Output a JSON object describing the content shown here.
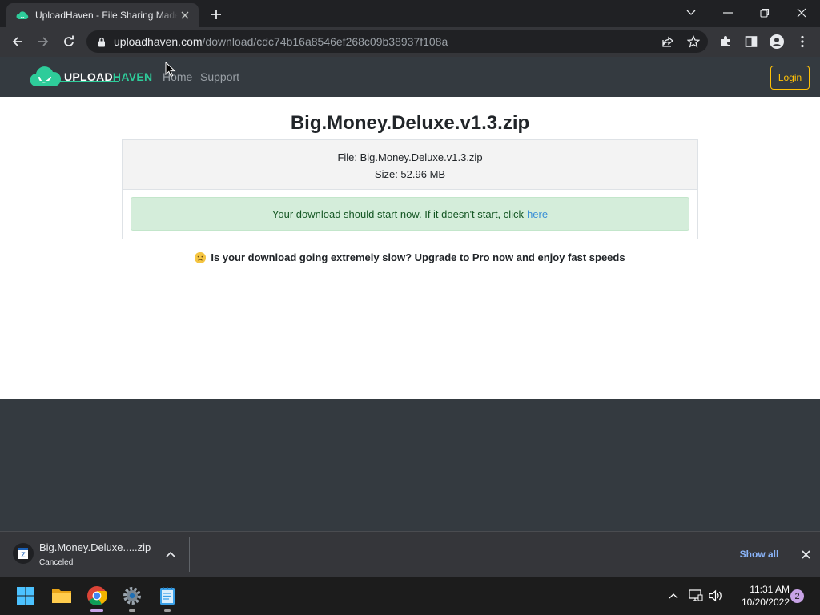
{
  "browser": {
    "tab_title": "UploadHaven - File Sharing Made",
    "url_host": "uploadhaven.com",
    "url_path": "/download/cdc74b16a8546ef268c09b38937f108a"
  },
  "site": {
    "logo_part1": "UPLOAD",
    "logo_part2": "HAVEN",
    "nav": [
      {
        "label": "Home"
      },
      {
        "label": "Support"
      }
    ],
    "login_label": "Login"
  },
  "download": {
    "title": "Big.Money.Deluxe.v1.3.zip",
    "file_line": "File: Big.Money.Deluxe.v1.3.zip",
    "size_line": "Size: 52.96 MB",
    "alert_text": "Your download should start now. If it doesn't start, click",
    "alert_link": "here",
    "slow_text": "Is your download going extremely slow? Upgrade to Pro now and enjoy fast speeds"
  },
  "download_shelf": {
    "item_name": "Big.Money.Deluxe.....zip",
    "item_status": "Canceled",
    "show_all_label": "Show all"
  },
  "taskbar": {
    "time": "11:31 AM",
    "date": "10/20/2022",
    "notification_count": "2"
  },
  "colors": {
    "brand_green": "#2ecc9a",
    "navbar": "#343a40",
    "login_yellow": "#ffc107",
    "alert_bg": "#d4edda",
    "link_blue": "#3b8fd6"
  },
  "icons": [
    "cloud-favicon-icon",
    "close-icon",
    "plus-icon",
    "chevron-down-icon",
    "minimize-icon",
    "restore-icon",
    "back-arrow-icon",
    "forward-arrow-icon",
    "reload-icon",
    "lock-icon",
    "share-icon",
    "star-icon",
    "extensions-icon",
    "side-panel-icon",
    "profile-icon",
    "kebab-menu-icon",
    "sad-face-icon",
    "archive-icon",
    "chevron-up-icon",
    "windows-start-icon",
    "file-explorer-icon",
    "chrome-icon",
    "settings-icon",
    "notepad-icon",
    "network-icon",
    "volume-icon"
  ]
}
